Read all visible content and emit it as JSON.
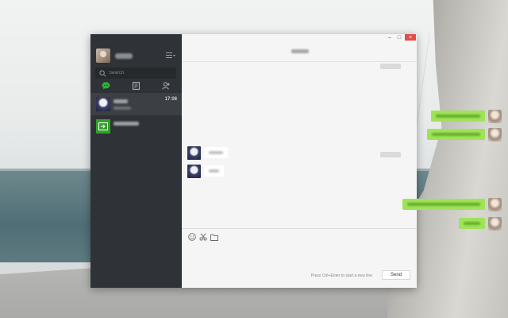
{
  "window": {
    "controls": {
      "minimize": "–",
      "maximize": "□",
      "close": "×"
    }
  },
  "sidebar": {
    "search_placeholder": "Search",
    "tabs": [
      {
        "name": "chats",
        "icon": "chat-bubble-icon",
        "active": true,
        "color": "#2bb13d"
      },
      {
        "name": "contacts-book",
        "icon": "contacts-book-icon",
        "active": false
      },
      {
        "name": "add-contact",
        "icon": "add-contact-icon",
        "active": false
      }
    ],
    "chats": [
      {
        "time": "17:08",
        "active": true
      },
      {
        "time": "",
        "active": false
      }
    ]
  },
  "composer": {
    "tools": [
      "emoji-icon",
      "scissors-icon",
      "folder-icon"
    ],
    "hint": "Press Ctrl+Enter to start a new line",
    "send_label": "Send"
  },
  "colors": {
    "sidebar_bg": "#2f3236",
    "outgoing_bubble": "#9fe358",
    "incoming_bubble": "#ffffff",
    "accent": "#2bb13d"
  }
}
